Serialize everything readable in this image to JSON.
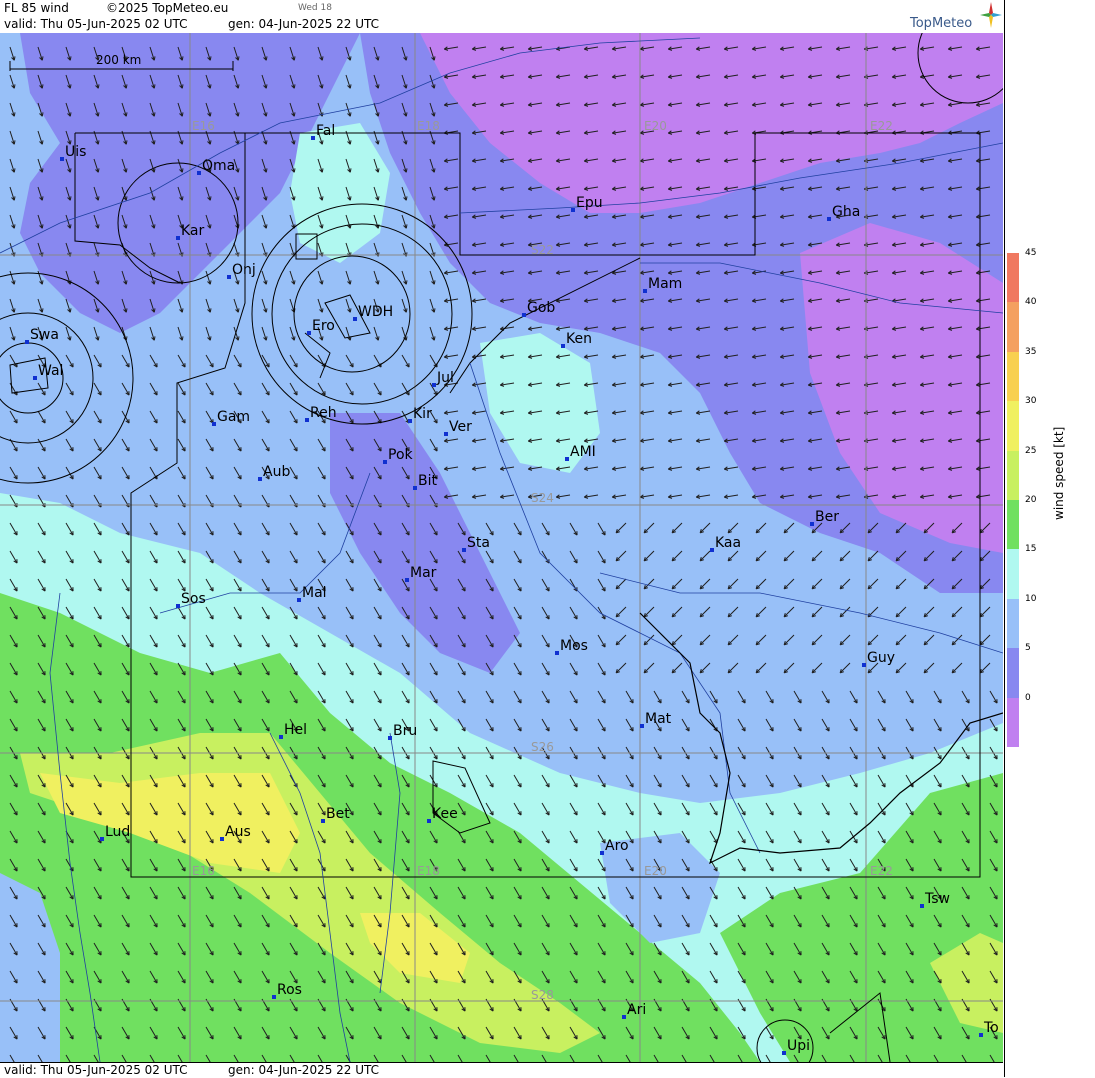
{
  "header": {
    "title": "FL 85 wind",
    "copyright": "©2025 TopMeteo.eu",
    "day_tag": "Wed 18",
    "valid": "valid:  Thu   05-Jun-2025  02 UTC",
    "gen": "gen: 04-Jun-2025 22 UTC",
    "brand": "TopMeteo"
  },
  "footer": {
    "valid": "valid:  Thu   05-Jun-2025  02 UTC",
    "gen": "gen: 04-Jun-2025 22 UTC"
  },
  "scale_bar": {
    "label": "200 km"
  },
  "grid_labels": {
    "lon": [
      "E16",
      "E18",
      "E20",
      "E22"
    ],
    "lat": [
      "S22",
      "S24",
      "S26",
      "S28"
    ]
  },
  "legend": {
    "title": "wind  speed  [kt]",
    "ticks": [
      "45",
      "40",
      "35",
      "30",
      "25",
      "20",
      "15",
      "10",
      "5",
      "0"
    ],
    "colors": [
      "#f07860",
      "#f4a060",
      "#f8d050",
      "#f0f060",
      "#c8f060",
      "#70e060",
      "#b0f8f0",
      "#98c0f8",
      "#8888f0",
      "#c080f0"
    ]
  },
  "places": [
    {
      "id": "uis",
      "name": "Uis"
    },
    {
      "id": "fal",
      "name": "Fal"
    },
    {
      "id": "oma",
      "name": "Oma"
    },
    {
      "id": "kar",
      "name": "Kar"
    },
    {
      "id": "onj",
      "name": "Onj"
    },
    {
      "id": "epu",
      "name": "Epu"
    },
    {
      "id": "gha",
      "name": "Gha"
    },
    {
      "id": "mam",
      "name": "Mam"
    },
    {
      "id": "gob",
      "name": "Gob"
    },
    {
      "id": "wdh",
      "name": "WDH"
    },
    {
      "id": "ero",
      "name": "Ero"
    },
    {
      "id": "ken",
      "name": "Ken"
    },
    {
      "id": "swa",
      "name": "Swa"
    },
    {
      "id": "wal",
      "name": "Wal"
    },
    {
      "id": "jul",
      "name": "Jul"
    },
    {
      "id": "gam",
      "name": "Gam"
    },
    {
      "id": "reh",
      "name": "Reh"
    },
    {
      "id": "kir",
      "name": "Kir"
    },
    {
      "id": "ver",
      "name": "Ver"
    },
    {
      "id": "ami",
      "name": "AMI"
    },
    {
      "id": "pok",
      "name": "Pok"
    },
    {
      "id": "aub",
      "name": "Aub"
    },
    {
      "id": "bit",
      "name": "Bit"
    },
    {
      "id": "ber",
      "name": "Ber"
    },
    {
      "id": "sta",
      "name": "Sta"
    },
    {
      "id": "kaa",
      "name": "Kaa"
    },
    {
      "id": "mar",
      "name": "Mar"
    },
    {
      "id": "sos",
      "name": "Sos"
    },
    {
      "id": "mal",
      "name": "Mal"
    },
    {
      "id": "mos",
      "name": "Mos"
    },
    {
      "id": "guy",
      "name": "Guy"
    },
    {
      "id": "mat",
      "name": "Mat"
    },
    {
      "id": "hel",
      "name": "Hel"
    },
    {
      "id": "bru",
      "name": "Bru"
    },
    {
      "id": "bet",
      "name": "Bet"
    },
    {
      "id": "kee",
      "name": "Kee"
    },
    {
      "id": "lud",
      "name": "Lud"
    },
    {
      "id": "aus",
      "name": "Aus"
    },
    {
      "id": "aro",
      "name": "Aro"
    },
    {
      "id": "tsw",
      "name": "Tsw"
    },
    {
      "id": "ros",
      "name": "Ros"
    },
    {
      "id": "ari",
      "name": "Ari"
    },
    {
      "id": "upi",
      "name": "Upi"
    },
    {
      "id": "to",
      "name": "To"
    }
  ]
}
